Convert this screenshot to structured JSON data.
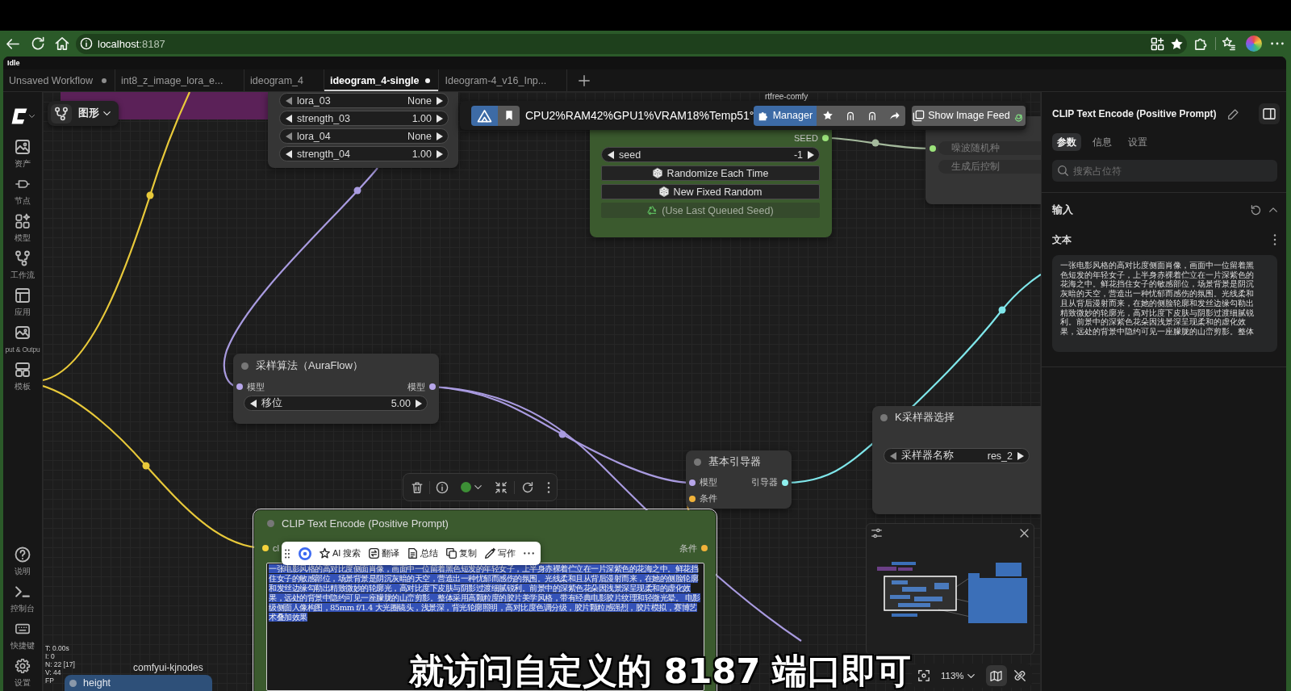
{
  "browser": {
    "address_host": "localhost",
    "address_port": ":8187"
  },
  "status": "Idle",
  "tabs": [
    {
      "label": "Unsaved Workflow",
      "modified": true,
      "selected": false
    },
    {
      "label": "int8_z_image_lora_e...",
      "modified": false,
      "selected": false
    },
    {
      "label": "ideogram_4",
      "modified": false,
      "selected": false
    },
    {
      "label": "ideogram_4-single",
      "modified": true,
      "selected": true
    },
    {
      "label": "Ideogram-4_v16_Inp...",
      "modified": false,
      "selected": false
    }
  ],
  "sidebar": {
    "items": [
      {
        "label": "资产"
      },
      {
        "label": "节点"
      },
      {
        "label": "模型"
      },
      {
        "label": "工作流"
      },
      {
        "label": "应用"
      },
      {
        "label": "put & Outpu"
      },
      {
        "label": "模板"
      }
    ],
    "bottom_items": [
      {
        "label": "说明"
      },
      {
        "label": "控制台"
      },
      {
        "label": "快捷键"
      },
      {
        "label": "设置"
      }
    ]
  },
  "canvas": {
    "graph_menu": "图形",
    "groups": [
      {
        "title": "rtfree-comfy"
      },
      {
        "title": "comfyui-kjnodes"
      }
    ],
    "monitor_bar": {
      "stats": "CPU2%RAM42%GPU1%VRAM18%Temp51°",
      "manager": "Manager",
      "image_feed": "Show Image Feed"
    },
    "nodes": [
      {
        "color": "#353535",
        "selected": false,
        "widgets": [
          {
            "kind": "combo",
            "label": "lora_03",
            "value": "None"
          },
          {
            "kind": "number",
            "label": "strength_03",
            "value": "1.00"
          },
          {
            "kind": "combo",
            "label": "lora_04",
            "value": "None"
          },
          {
            "kind": "number",
            "label": "strength_04",
            "value": "1.00"
          }
        ]
      },
      {
        "color": "#3b5a2e",
        "selected": false,
        "outputs": [
          {
            "label": "SEED",
            "color": "#9be27a"
          }
        ],
        "widgets": [
          {
            "kind": "number",
            "label": "seed",
            "value": "-1"
          },
          {
            "kind": "button",
            "label": "Randomize Each Time",
            "disabled": false
          },
          {
            "kind": "button",
            "label": "New Fixed Random",
            "disabled": false
          },
          {
            "kind": "button",
            "label": "(Use Last Queued Seed)",
            "disabled": true
          }
        ]
      },
      {
        "color": "#353535",
        "selected": false,
        "widgets": [
          {
            "kind": "socket",
            "label": "噪波随机种",
            "linked": true,
            "color": "#9be27a"
          },
          {
            "kind": "socket",
            "label": "生成后控制",
            "linked": false
          }
        ]
      },
      {
        "title": "采样算法（AuraFlow）",
        "color": "#353535",
        "selected": false,
        "inputs": [
          {
            "label": "模型",
            "color": "#b7a6ea"
          }
        ],
        "outputs": [
          {
            "label": "模型",
            "color": "#b7a6ea"
          }
        ],
        "widgets": [
          {
            "kind": "number",
            "label": "移位",
            "value": "5.00"
          }
        ]
      },
      {
        "title": "基本引导器",
        "color": "#353535",
        "selected": false,
        "inputs": [
          {
            "label": "模型",
            "color": "#b7a6ea"
          },
          {
            "label": "条件",
            "color": "#f0b23a"
          }
        ],
        "outputs": [
          {
            "label": "引导器",
            "color": "#8ef0ee"
          }
        ]
      },
      {
        "title": "K采样器选择",
        "color": "#353535",
        "selected": false,
        "widgets": [
          {
            "kind": "combo",
            "label": "采样器名称",
            "value": "res_2"
          }
        ]
      },
      {
        "title": "CLIP Text Encode (Positive Prompt)",
        "color": "#3b5a2e",
        "selected": true,
        "inputs": [
          {
            "label": "cl",
            "color": "#f5d23c"
          }
        ],
        "outputs": [
          {
            "label": "条件",
            "color": "#f0b23a"
          }
        ],
        "widgets": [
          {
            "kind": "text",
            "highlighted": true,
            "value": "一张电影风格的高对比度侧面肖像，画面中一位留着黑色短发的年轻女子，上半身赤裸着伫立在一片深紫色的花海之中。鲜花挡住女子的敏感部位，场景背景是阴沉灰暗的天空，营造出一种忧郁而感伤的氛围。光线柔和且从背后漫射而来，在她的侧脸轮廓和发丝边缘勾勒出精致微妙的轮廓光，高对比度下皮肤与阴影过渡细腻锐利。前景中的深紫色花朵因浅景深呈现柔和的虚化效果，远处的背景中隐约可见一座朦胧的山峦剪影。整体采用高颗粒度的胶片美学风格，带有经典电影胶片纹理和轻微光晕。 电影级侧面人像构图，85mm f/1.4 大光圈镜头，浅景深，背光轮廓照明，高对比度色调分级，胶片颗粒感强烈，胶片模拟，赛博艺术叠加效果"
          }
        ]
      },
      {
        "title": "height",
        "color": "#2e5079",
        "selected": false
      }
    ],
    "ai_toolbar": {
      "actions": [
        {
          "label": "AI 搜索"
        },
        {
          "label": "翻译"
        },
        {
          "label": "总结"
        },
        {
          "label": "复制"
        },
        {
          "label": "写作"
        }
      ]
    },
    "minimap_visible": true,
    "zoom": "113%",
    "stats": [
      "T: 0.00s",
      "I: 0",
      "N: 22 [17]",
      "V: 44",
      "FP"
    ]
  },
  "properties": {
    "title": "CLIP Text Encode (Positive Prompt)",
    "tabs": [
      {
        "label": "参数",
        "selected": true
      },
      {
        "label": "信息",
        "selected": false
      },
      {
        "label": "设置",
        "selected": false
      }
    ],
    "search_placeholder": "搜索占位符",
    "section": {
      "title": "输入",
      "expanded": true,
      "fields": [
        {
          "label": "文本",
          "value": "一张电影风格的高对比度侧面肖像，画面中一位留着黑色短发的年轻女子，上半身赤裸着伫立在一片深紫色的花海之中。鲜花挡住女子的敏感部位，场景背景是阴沉灰暗的天空，营造出一种忧郁而感伤的氛围。光线柔和且从背后漫射而来，在她的侧脸轮廓和发丝边缘勾勒出精致微妙的轮廓光，高对比度下皮肤与阴影过渡细腻锐利。前景中的深紫色花朵因浅景深呈现柔和的虚化效果，远处的背景中隐约可见一座朦胧的山峦剪影。整体"
        }
      ]
    }
  },
  "subtitle": "就访问自定义的 8187 端口即可"
}
